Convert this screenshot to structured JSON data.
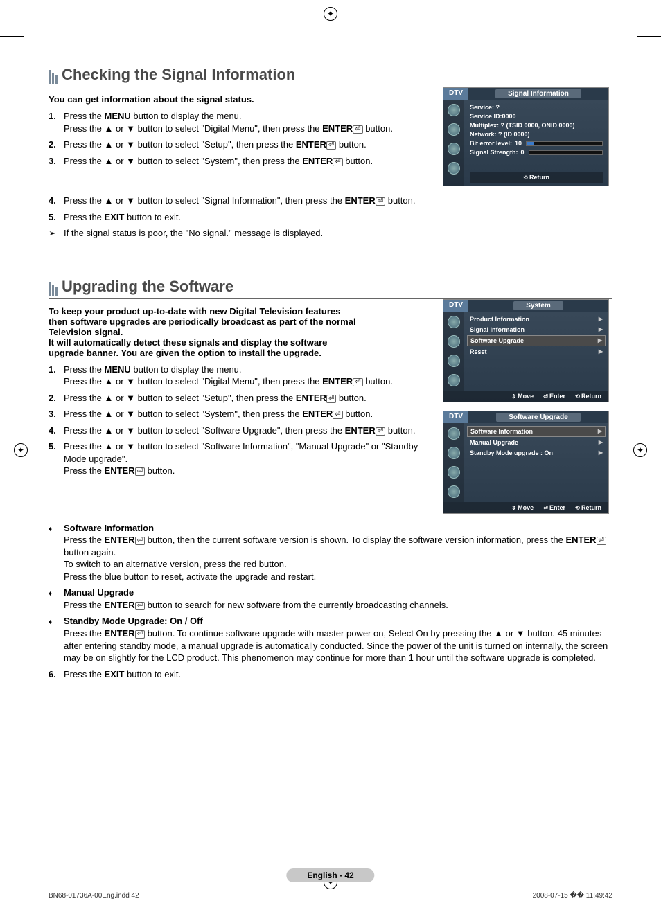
{
  "section1": {
    "title": "Checking the Signal Information",
    "intro": "You can get information about the signal status.",
    "steps": [
      "Press the <b>MENU</b> button to display the menu.<br>Press the ▲ or ▼ button to select \"Digital Menu\", then press the <b>ENTER</b><span class='enter-icon'>⏎</span> button.",
      "Press the ▲ or ▼ button to select \"Setup\", then press the <b>ENTER</b><span class='enter-icon'>⏎</span> button.",
      "Press the ▲ or ▼ button to select \"System\", then press the <b>ENTER</b><span class='enter-icon'>⏎</span> button.",
      "Press the ▲ or ▼ button to select \"Signal Information\", then press the <b>ENTER</b><span class='enter-icon'>⏎</span> button.",
      "Press the <b>EXIT</b> button to exit."
    ],
    "note": "If the signal status is poor, the \"No signal.\" message is displayed."
  },
  "section2": {
    "title": "Upgrading the Software",
    "intro": "To keep your product up-to-date with new Digital Television features then software upgrades are periodically broadcast as part of the normal Television signal.\nIt will automatically detect these signals and display the software upgrade banner. You are given the option to install the upgrade.",
    "steps": [
      "Press the <b>MENU</b> button to display the menu.<br>Press the ▲ or ▼ button to select \"Digital Menu\", then press the <b>ENTER</b><span class='enter-icon'>⏎</span> button.",
      "Press the ▲ or ▼ button to select \"Setup\", then press the <b>ENTER</b><span class='enter-icon'>⏎</span> button.",
      "Press the ▲ or ▼ button to select \"System\", then press the <b>ENTER</b><span class='enter-icon'>⏎</span> button.",
      "Press the ▲ or ▼ button to select \"Software Upgrade\", then press the <b>ENTER</b><span class='enter-icon'>⏎</span> button.",
      "Press the ▲ or ▼ button to select \"Software Information\", \"Manual Upgrade\" or \"Standby Mode upgrade\".<br>Press the <b>ENTER</b><span class='enter-icon'>⏎</span> button."
    ],
    "bullets": [
      {
        "title": "Software Information",
        "body": "Press the <b>ENTER</b><span class='enter-icon'>⏎</span> button, then the current software version is shown. To display the software version information, press the <b>ENTER</b><span class='enter-icon'>⏎</span> button again.<br>To switch to an alternative version, press the red button.<br>Press the blue button to reset, activate the upgrade and restart."
      },
      {
        "title": "Manual Upgrade",
        "body": "Press the <b>ENTER</b><span class='enter-icon'>⏎</span> button to search for new software from the currently broadcasting channels."
      },
      {
        "title": "Standby Mode Upgrade: On / Off",
        "body": "Press the <b>ENTER</b><span class='enter-icon'>⏎</span> button. To continue software upgrade with master power on, Select On by pressing the ▲ or ▼ button. 45 minutes after entering standby mode, a manual upgrade is automatically conducted. Since the power of the unit is turned on internally, the screen may be on slightly for the LCD product. This phenomenon may continue for more than 1 hour until the software upgrade is completed."
      }
    ],
    "step6": "Press the <b>EXIT</b> button to exit."
  },
  "osd1": {
    "dtv": "DTV",
    "title": "Signal Information",
    "lines": {
      "service": "Service: ?",
      "service_id": "Service ID:0000",
      "multiplex": "Multiplex: ? (TSID 0000, ONID 0000)",
      "network": "Network: ? (ID 0000)",
      "bit_label": "Bit error level:",
      "bit_value": "10",
      "sig_label": "Signal Strength:",
      "sig_value": "0"
    },
    "return": "Return"
  },
  "osd2": {
    "dtv": "DTV",
    "title": "System",
    "items": [
      "Product Information",
      "Signal Information",
      "Software Upgrade",
      "Reset"
    ],
    "selected_index": 2,
    "footer": {
      "move": "Move",
      "enter": "Enter",
      "return": "Return"
    }
  },
  "osd3": {
    "dtv": "DTV",
    "title": "Software Upgrade",
    "items": [
      "Software Information",
      "Manual Upgrade",
      "Standby Mode upgrade : On"
    ],
    "selected_index": 0,
    "footer": {
      "move": "Move",
      "enter": "Enter",
      "return": "Return"
    }
  },
  "page_number": "English - 42",
  "footer_left": "BN68-01736A-00Eng.indd   42",
  "footer_right": "2008-07-15   �� 11:49:42"
}
